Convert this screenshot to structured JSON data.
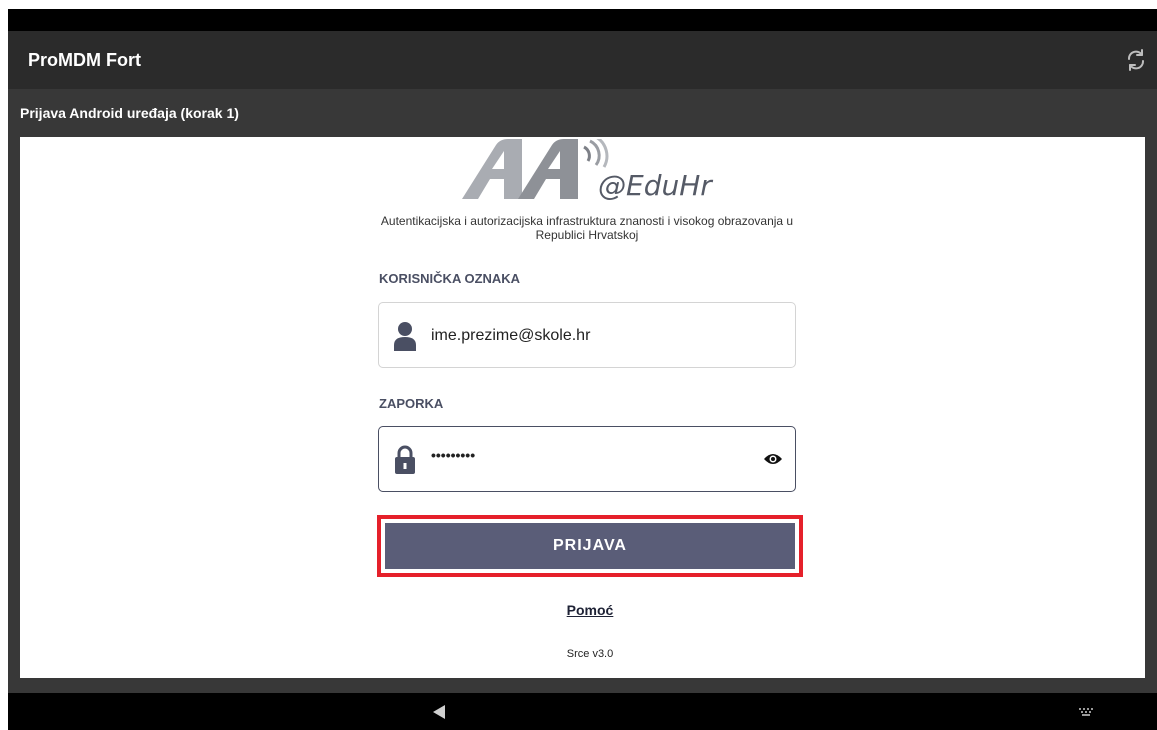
{
  "app": {
    "title": "ProMDM Fort",
    "subtitle": "Prijava Android uređaja (korak 1)"
  },
  "logo": {
    "wordmark": "@EduHr",
    "tagline": "Autentikacijska i autorizacijska infrastruktura znanosti i visokog obrazovanja u Republici Hrvatskoj"
  },
  "form": {
    "username_label": "KORISNIČKA OZNAKA",
    "username_value": "ime.prezime@skole.hr",
    "password_label": "ZAPORKA",
    "password_value": "•••••••••",
    "login_button": "PRIJAVA",
    "help_link": "Pomoć",
    "version": "Srce v3.0"
  },
  "icons": {
    "refresh": "refresh-icon",
    "user": "user-icon",
    "lock": "lock-icon",
    "eye": "eye-icon",
    "back": "back-icon",
    "keyboard": "keyboard-icon"
  },
  "colors": {
    "app_bar": "#2b2b2b",
    "sub_bar": "#383838",
    "button": "#5a5d78",
    "highlight": "#e5202a",
    "label": "#4a4f63"
  }
}
